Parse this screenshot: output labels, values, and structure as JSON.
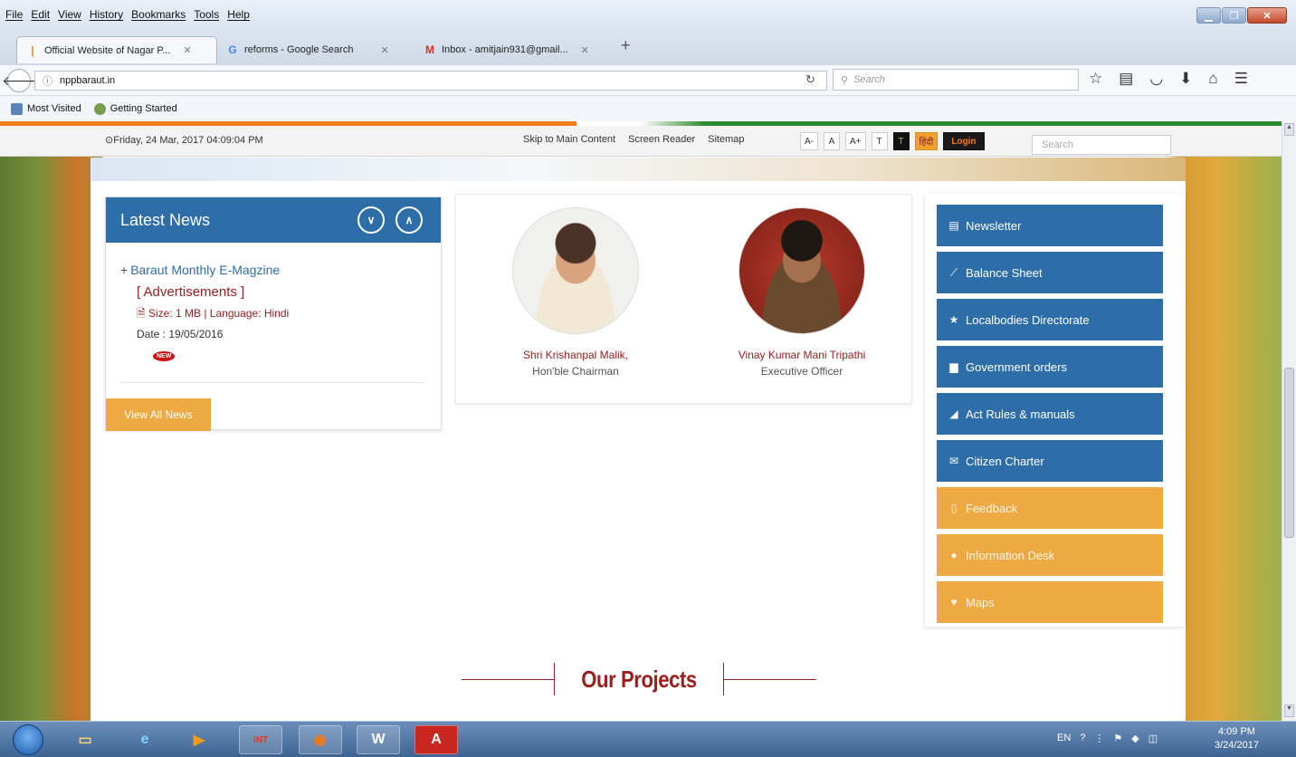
{
  "browser": {
    "menu": [
      "File",
      "Edit",
      "View",
      "History",
      "Bookmarks",
      "Tools",
      "Help"
    ],
    "tabs": [
      {
        "title": "Official Website of Nagar P...",
        "favicon": "page-icon"
      },
      {
        "title": "reforms - Google Search",
        "favicon": "google-icon"
      },
      {
        "title": "Inbox - amitjain931@gmail...",
        "favicon": "gmail-icon"
      }
    ],
    "url": "nppbaraut.in",
    "search_placeholder": "Search",
    "bookmarks": [
      "Most Visited",
      "Getting Started"
    ]
  },
  "site": {
    "datetime": "Friday, 24 Mar, 2017 04:09:04 PM",
    "top_links": [
      "Skip to Main Content",
      "Screen Reader",
      "Sitemap"
    ],
    "font_buttons": [
      "A-",
      "A",
      "A+",
      "T",
      "T"
    ],
    "hindi": "हिंदी",
    "login": "Login",
    "search_placeholder": "Search"
  },
  "news": {
    "heading": "Latest News",
    "item_title": "Baraut Monthly E-Magzine",
    "item_category": "[ Advertisements ]",
    "item_meta": "Size: 1 MB | Language: Hindi",
    "item_date": "Date : 19/05/2016",
    "new_badge": "NEW",
    "view_all": "View All News"
  },
  "officials": [
    {
      "name": "Shri Krishanpal Malik,",
      "role": "Hon'ble Chairman"
    },
    {
      "name": "Vinay Kumar Mani Tripathi",
      "role": "Executive Officer"
    }
  ],
  "sidemenu": [
    {
      "label": "Newsletter",
      "icon": "newspaper-icon",
      "color": "#2d6ea8"
    },
    {
      "label": "Balance Sheet",
      "icon": "chart-icon",
      "color": "#2d6ea8"
    },
    {
      "label": "Localbodies Directorate",
      "icon": "star-icon",
      "color": "#2d6ea8"
    },
    {
      "label": "Government orders",
      "icon": "document-icon",
      "color": "#2d6ea8"
    },
    {
      "label": "Act Rules & manuals",
      "icon": "book-icon",
      "color": "#2d6ea8"
    },
    {
      "label": "Citizen Charter",
      "icon": "envelope-icon",
      "color": "#2d6ea8"
    },
    {
      "label": "Feedback",
      "icon": "file-icon",
      "color": "#efa942"
    },
    {
      "label": "Information Desk",
      "icon": "info-icon",
      "color": "#efa942"
    },
    {
      "label": "Maps",
      "icon": "map-marker-icon",
      "color": "#efa942"
    }
  ],
  "projects_heading": "Our Projects",
  "taskbar": {
    "tray_lang": "EN",
    "time": "4:09 PM",
    "date": "3/24/2017"
  }
}
